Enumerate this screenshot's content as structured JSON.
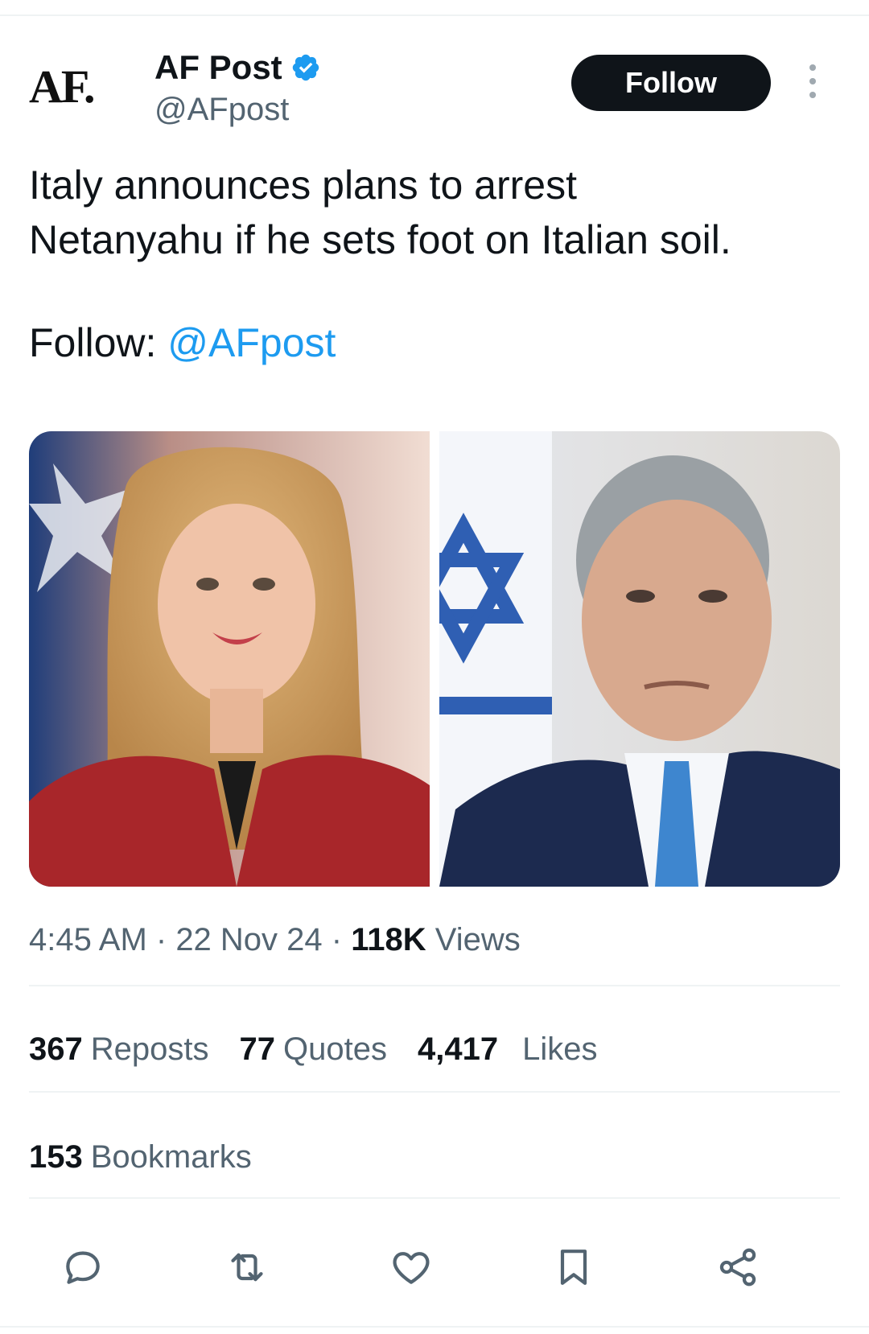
{
  "account": {
    "avatar_text": "AF.",
    "display_name": "AF Post",
    "handle": "@AFpost",
    "verified_icon": "verified-badge-icon",
    "follow_label": "Follow",
    "more_icon": "more-vertical-icon"
  },
  "tweet": {
    "lines": [
      "Italy announces plans to arrest",
      "Netanyahu if he sets foot on Italian soil."
    ],
    "follow_prefix": "Follow: ",
    "follow_mention": "@AFpost"
  },
  "media": [
    {
      "name": "photo-giorgia-meloni"
    },
    {
      "name": "photo-benjamin-netanyahu"
    }
  ],
  "meta": {
    "time": "4:45 AM",
    "separator": " · ",
    "date": "22 Nov 24",
    "views_count": "118K",
    "views_label": " Views"
  },
  "stats": {
    "reposts_count": "367",
    "reposts_label": "Reposts",
    "quotes_count": "77",
    "quotes_label": "Quotes",
    "likes_count": "4,417",
    "likes_label": "Likes",
    "bookmarks_count": "153",
    "bookmarks_label": "Bookmarks"
  },
  "actions": [
    {
      "icon": "reply-icon"
    },
    {
      "icon": "repost-icon"
    },
    {
      "icon": "like-icon"
    },
    {
      "icon": "bookmark-icon"
    },
    {
      "icon": "share-icon"
    }
  ],
  "colors": {
    "text": "#0f1419",
    "secondary": "#536471",
    "accent": "#1d9bf0",
    "divider": "#eff3f4"
  }
}
